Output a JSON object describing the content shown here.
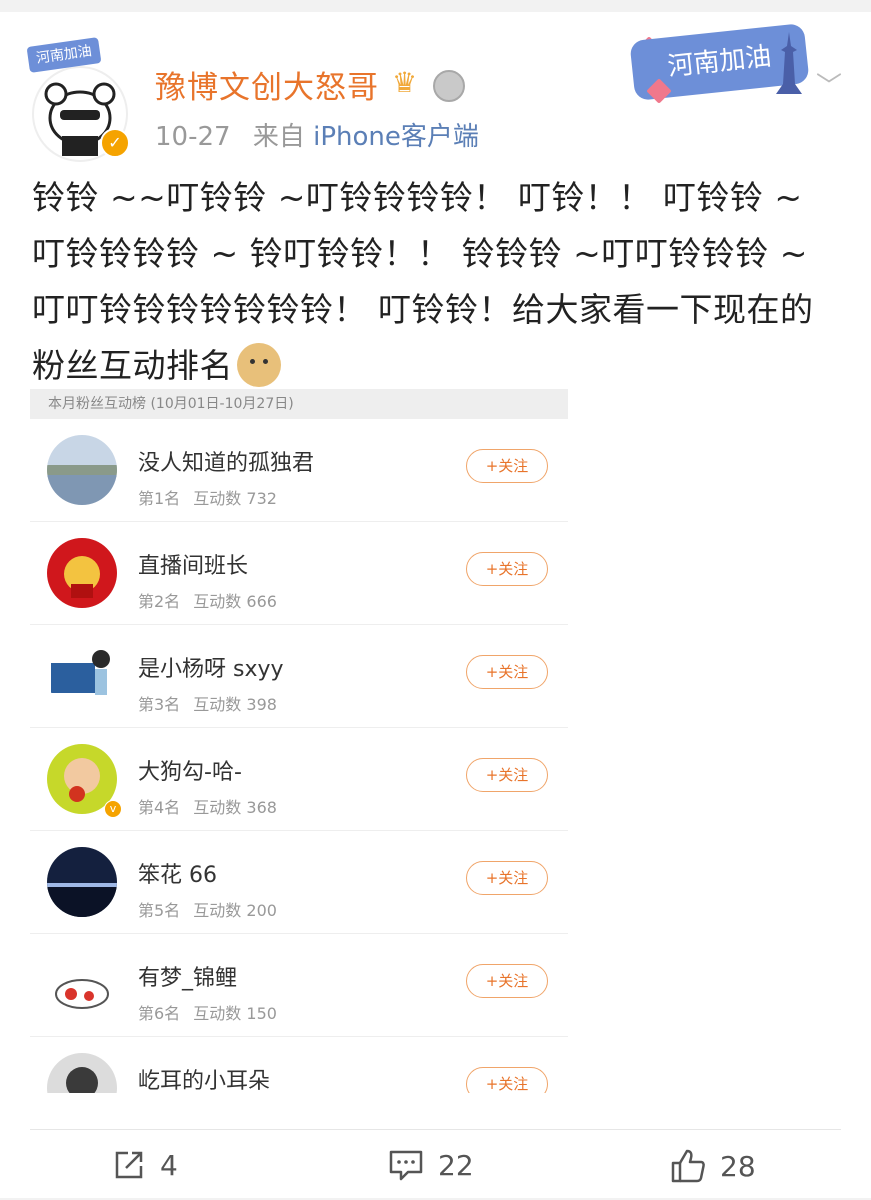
{
  "post": {
    "username": "豫博文创大怒哥",
    "avatar_tag": "河南加油",
    "sticker_text": "河南加油",
    "time": "10-27",
    "source_prefix": "来自",
    "source": "iPhone客户端",
    "text": "铃铃 ~~叮铃铃 ~叮铃铃铃铃！ 叮铃！！ 叮铃铃 ~叮铃铃铃铃 ~ 铃叮铃铃！！ 铃铃铃 ~叮叮铃铃铃 ~叮叮铃铃铃铃铃铃铃！ 叮铃铃！给大家看一下现在的粉丝互动排名"
  },
  "rank_panel": {
    "header": "本月粉丝互动榜 (10月01日-10月27日)",
    "follow_label": "+关注",
    "rows": [
      {
        "name": "没人知道的孤独君",
        "rank": "第1名",
        "stat_label": "互动数",
        "count": "732"
      },
      {
        "name": "直播间班长",
        "rank": "第2名",
        "stat_label": "互动数",
        "count": "666"
      },
      {
        "name": "是小杨呀 sxyy",
        "rank": "第3名",
        "stat_label": "互动数",
        "count": "398"
      },
      {
        "name": "大狗勾-哈-",
        "rank": "第4名",
        "stat_label": "互动数",
        "count": "368"
      },
      {
        "name": "笨花 66",
        "rank": "第5名",
        "stat_label": "互动数",
        "count": "200"
      },
      {
        "name": "有梦_锦鲤",
        "rank": "第6名",
        "stat_label": "互动数",
        "count": "150"
      },
      {
        "name": "屹耳的小耳朵",
        "rank": "",
        "stat_label": "",
        "count": ""
      }
    ]
  },
  "actions": {
    "repost_count": "4",
    "comment_count": "22",
    "like_count": "28"
  },
  "colors": {
    "accent": "#e8742b",
    "link": "#5b7fb6",
    "verified": "#f5a300"
  }
}
